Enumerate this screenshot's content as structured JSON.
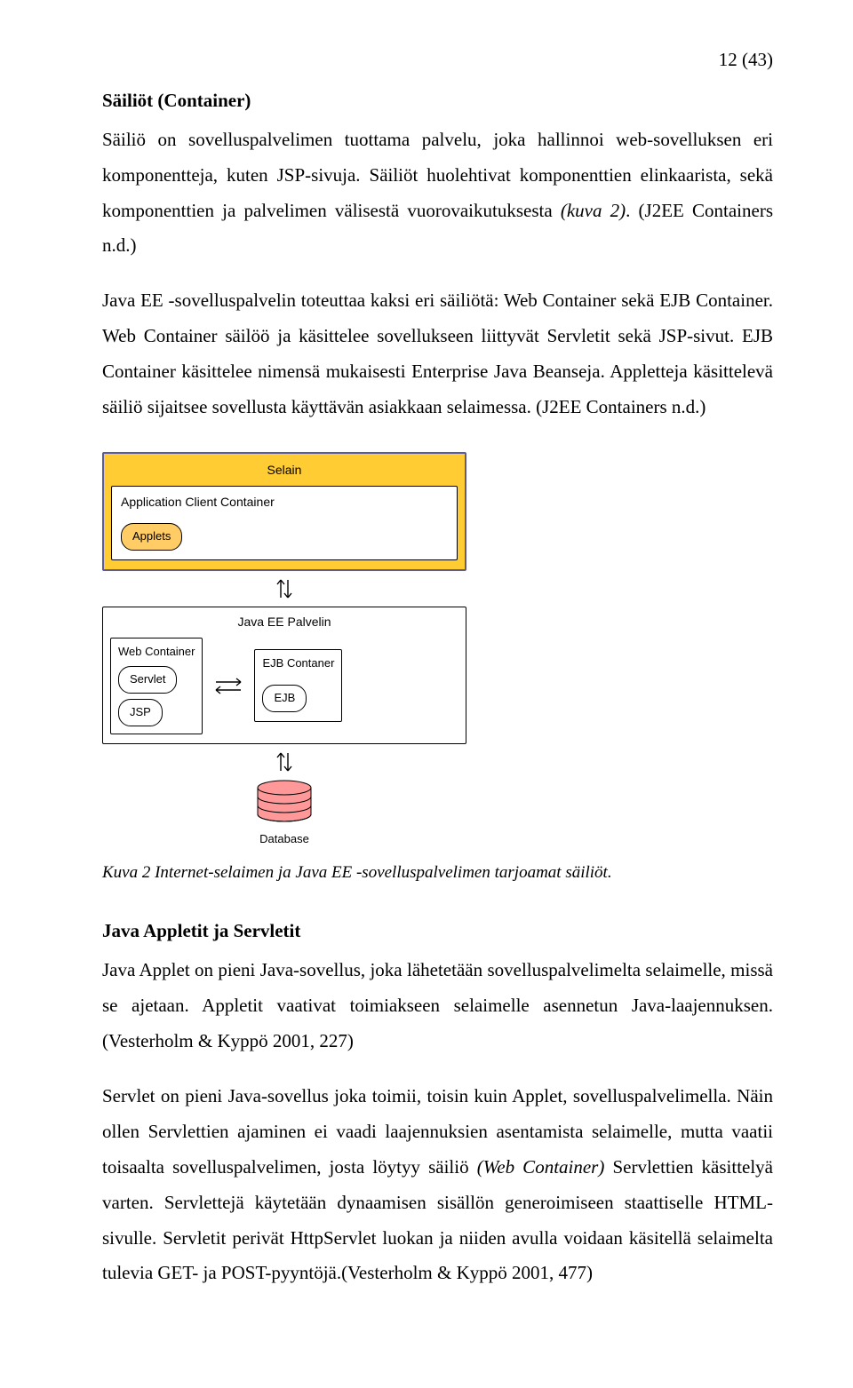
{
  "page_number": "12 (43)",
  "h_sailiot": "Säiliöt (Container)",
  "p1": "Säiliö on sovelluspalvelimen tuottama palvelu, joka hallinnoi web-sovelluksen eri komponentteja, kuten JSP-sivuja. Säiliöt huolehtivat komponenttien elinkaarista, sekä komponenttien ja palvelimen välisestä vuorovaikutuksesta ",
  "p1_it": "(kuva 2)",
  "p1_tail": ". (J2EE Containers n.d.)",
  "p2": "Java EE -sovelluspalvelin toteuttaa kaksi eri säiliötä: Web Container sekä EJB Container. Web Container säilöö ja käsittelee sovellukseen liittyvät Servletit sekä JSP-sivut. EJB Container käsittelee nimensä mukaisesti Enterprise Java Beanseja. Appletteja käsittelevä säiliö sijaitsee sovellusta käyttävän asiakkaan selaimessa. (J2EE Containers n.d.)",
  "diagram": {
    "selain": "Selain",
    "acc": "Application Client Container",
    "applets": "Applets",
    "javaee": "Java EE Palvelin",
    "webc": "Web Container",
    "servlet": "Servlet",
    "jsp": "JSP",
    "ejbc": "EJB Contaner",
    "ejb": "EJB",
    "database": "Database"
  },
  "caption": "Kuva 2 Internet-selaimen ja Java EE -sovelluspalvelimen tarjoamat säiliöt.",
  "h_applet": "Java Appletit ja Servletit",
  "p3": "Java Applet on pieni Java-sovellus, joka lähetetään sovelluspalvelimelta selaimelle, missä se ajetaan. Appletit vaativat toimiakseen selaimelle asennetun Java-laajennuksen. (Vesterholm & Kyppö 2001, 227)",
  "p4a": "Servlet on pieni Java-sovellus joka toimii, toisin kuin Applet, sovelluspalvelimella. Näin ollen Servlettien ajaminen ei vaadi laajennuksien asentamista selaimelle, mutta vaatii toisaalta sovelluspalvelimen, josta löytyy säiliö ",
  "p4_it": "(Web Container)",
  "p4b": " Servlettien käsittelyä varten. Servlettejä käytetään dynaamisen sisällön generoimiseen staattiselle HTML-sivulle. Servletit perivät HttpServlet luokan ja niiden avulla voidaan käsitellä selaimelta tulevia GET- ja POST-pyyntöjä.(Vesterholm & Kyppö 2001, 477)"
}
